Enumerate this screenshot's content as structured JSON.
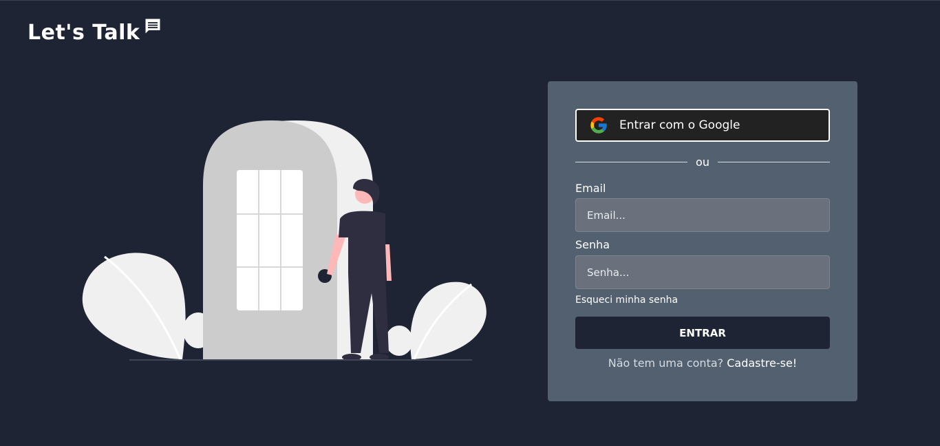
{
  "brand": {
    "title": "Let's Talk",
    "icon": "chat-bubble-icon"
  },
  "login": {
    "google_button_label": "Entrar com o Google",
    "divider_text": "ou",
    "email_label": "Email",
    "email_placeholder": "Email...",
    "email_value": "",
    "password_label": "Senha",
    "password_placeholder": "Senha...",
    "password_value": "",
    "forgot_link": "Esqueci minha senha",
    "submit_label": "ENTRAR",
    "signup_prompt": "Não tem uma conta?",
    "signup_link": "Cadastre-se!"
  },
  "colors": {
    "background": "#1f2434",
    "card": "#536070",
    "input": "#6a717c",
    "google_button": "#222222",
    "submit_button": "#1f2434"
  }
}
